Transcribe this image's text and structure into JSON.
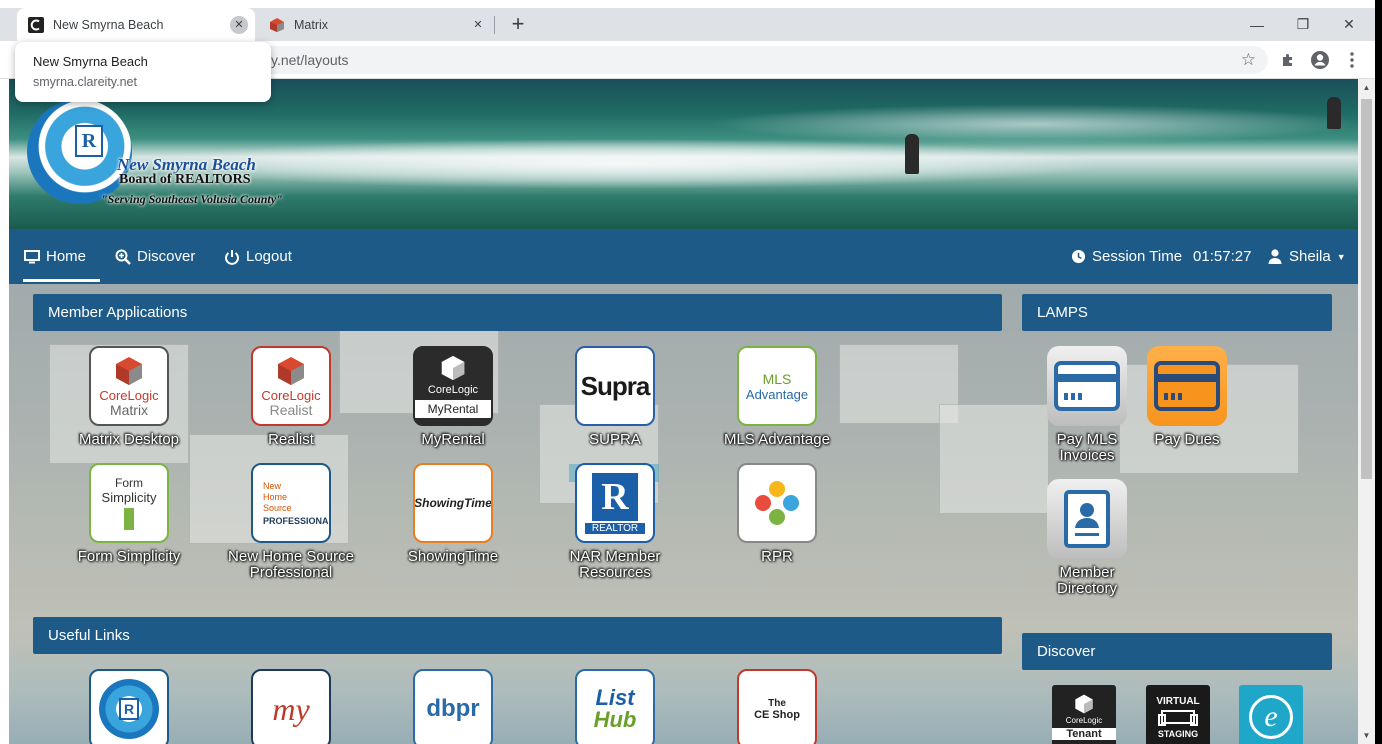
{
  "browser": {
    "tabs": [
      {
        "title": "New Smyrna Beach",
        "active": true
      },
      {
        "title": "Matrix",
        "active": false
      }
    ],
    "url_visible": "y.net/layouts",
    "tooltip": {
      "title": "New Smyrna Beach",
      "url": "smyrna.clareity.net"
    },
    "new_tab": "+",
    "controls": {
      "minimize": "—",
      "maximize": "❐",
      "close": "✕"
    }
  },
  "banner": {
    "org_line1": "New Smyrna Beach",
    "org_line2": "Board of REALTORS",
    "tagline": "\"Serving Southeast Volusia County\"",
    "logo_letter": "R"
  },
  "nav": {
    "home": "Home",
    "discover": "Discover",
    "logout": "Logout",
    "session_label": "Session Time",
    "session_time": "01:57:27",
    "user": "Sheila"
  },
  "sections": {
    "member_apps": "Member Applications",
    "lamps": "LAMPS",
    "useful_links": "Useful Links",
    "discover": "Discover"
  },
  "apps": [
    {
      "label": "Matrix Desktop",
      "l1": "CoreLogic",
      "l2": "Matrix"
    },
    {
      "label": "Realist",
      "l1": "CoreLogic",
      "l2": "Realist"
    },
    {
      "label": "MyRental",
      "l1": "CoreLogic",
      "l2": "MyRental"
    },
    {
      "label": "SUPRA",
      "l1": "Supra"
    },
    {
      "label": "MLS Advantage",
      "l1": "MLS",
      "l2": "Advantage"
    },
    {
      "label": "Form Simplicity",
      "l1": "Form",
      "l2": "Simplicity"
    },
    {
      "label_1": "New Home Source",
      "label_2": "Professional",
      "l1": "New",
      "l2": "Home",
      "l3": "Source",
      "l4": "PROFESSIONAL"
    },
    {
      "label": "ShowingTime",
      "l1": "ShowingTime"
    },
    {
      "label_1": "NAR Member",
      "label_2": "Resources",
      "l1": "R",
      "l2": "REALTOR"
    },
    {
      "label": "RPR"
    }
  ],
  "lamps": [
    {
      "label_1": "Pay MLS",
      "label_2": "Invoices"
    },
    {
      "label": "Pay Dues"
    },
    {
      "label_1": "Member",
      "label_2": "Directory"
    }
  ],
  "links": [
    {
      "text": "R"
    },
    {
      "text": "my"
    },
    {
      "text": "dbpr"
    },
    {
      "text_1": "List",
      "text_2": "Hub"
    },
    {
      "text_1": "The",
      "text_2": "CE Shop"
    }
  ],
  "discover_items": [
    {
      "l1": "CoreLogic",
      "l2": "Tenant"
    },
    {
      "l1": "VIRTUAL",
      "l2": "STAGING"
    },
    {
      "l1": "e"
    }
  ],
  "colors": {
    "nav": "#1d5a88",
    "panel_header": "#1d5a88",
    "lamp_gray": "#d6d6d6",
    "lamp_orange": "#f7941d",
    "lamp_blue": "#2a6aa6"
  }
}
